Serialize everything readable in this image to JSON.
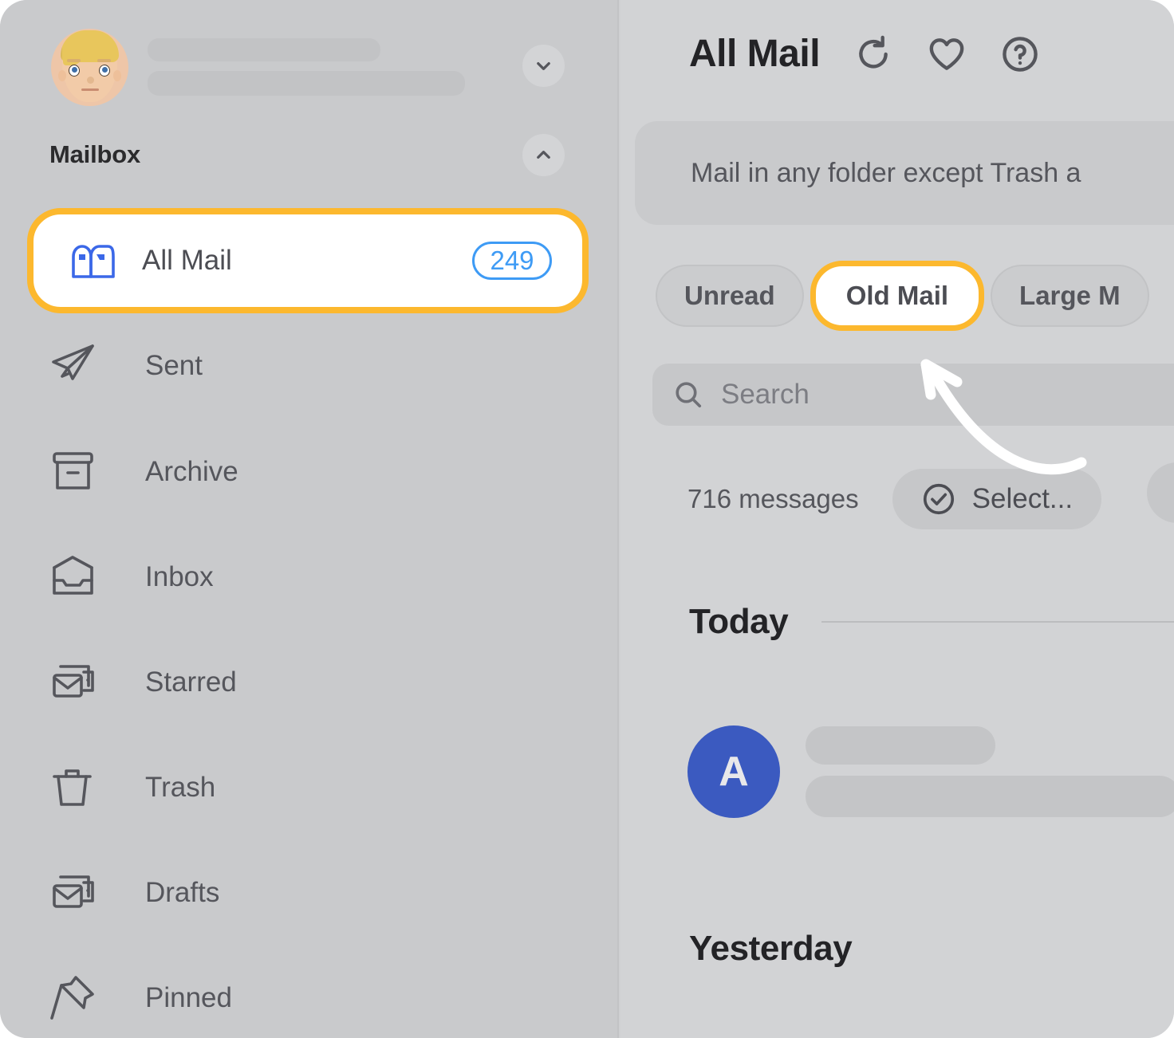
{
  "sidebar": {
    "account": {
      "name_placeholder": "",
      "email_placeholder": "",
      "avatar_icon": "memoji-avatar",
      "expand_icon": "chevron-down-icon"
    },
    "section_title": "Mailbox",
    "collapse_icon": "chevron-up-icon",
    "items": [
      {
        "label": "All Mail",
        "icon": "mailbox-icon",
        "badge": "249",
        "selected": true
      },
      {
        "label": "Sent",
        "icon": "paper-plane-icon",
        "badge": "",
        "selected": false
      },
      {
        "label": "Archive",
        "icon": "archive-box-icon",
        "badge": "",
        "selected": false
      },
      {
        "label": "Inbox",
        "icon": "inbox-tray-icon",
        "badge": "",
        "selected": false
      },
      {
        "label": "Starred",
        "icon": "stacked-envelopes-icon",
        "badge": "",
        "selected": false
      },
      {
        "label": "Trash",
        "icon": "trash-icon",
        "badge": "",
        "selected": false
      },
      {
        "label": "Drafts",
        "icon": "stacked-envelopes-icon",
        "badge": "",
        "selected": false
      },
      {
        "label": "Pinned",
        "icon": "pin-icon",
        "badge": "",
        "selected": false
      }
    ]
  },
  "main": {
    "title": "All Mail",
    "header_icons": [
      {
        "name": "refresh-icon"
      },
      {
        "name": "heart-icon"
      },
      {
        "name": "help-circle-icon"
      }
    ],
    "description": "Mail in any folder except Trash a",
    "chips": [
      {
        "label": "Unread",
        "selected": false
      },
      {
        "label": "Old Mail",
        "selected": true
      },
      {
        "label": "Large M",
        "selected": false
      }
    ],
    "search": {
      "placeholder": "Search",
      "icon": "search-icon",
      "value": ""
    },
    "message_count": "716 messages",
    "select_button": {
      "label": "Select...",
      "icon": "check-circle-icon"
    },
    "day_groups": [
      {
        "label": "Today"
      },
      {
        "label": "Yesterday"
      }
    ],
    "messages": [
      {
        "avatar_letter": "A",
        "avatar_color": "#3b5ac0",
        "subject": "",
        "preview": ""
      }
    ]
  },
  "annotation": {
    "arrow_icon": "curved-arrow-up-left",
    "color": "#ffffff",
    "points_to": "Old Mail"
  },
  "colors": {
    "highlight": "#fcb82e",
    "accent_blue": "#3e9bf5",
    "icon_blue": "#3b68e8",
    "avatar_blue": "#3b5ac0",
    "panel_bg": "#d2d3d5",
    "sidebar_bg": "#c9cacc",
    "text_dark": "#232326",
    "text_muted": "#55565c"
  }
}
